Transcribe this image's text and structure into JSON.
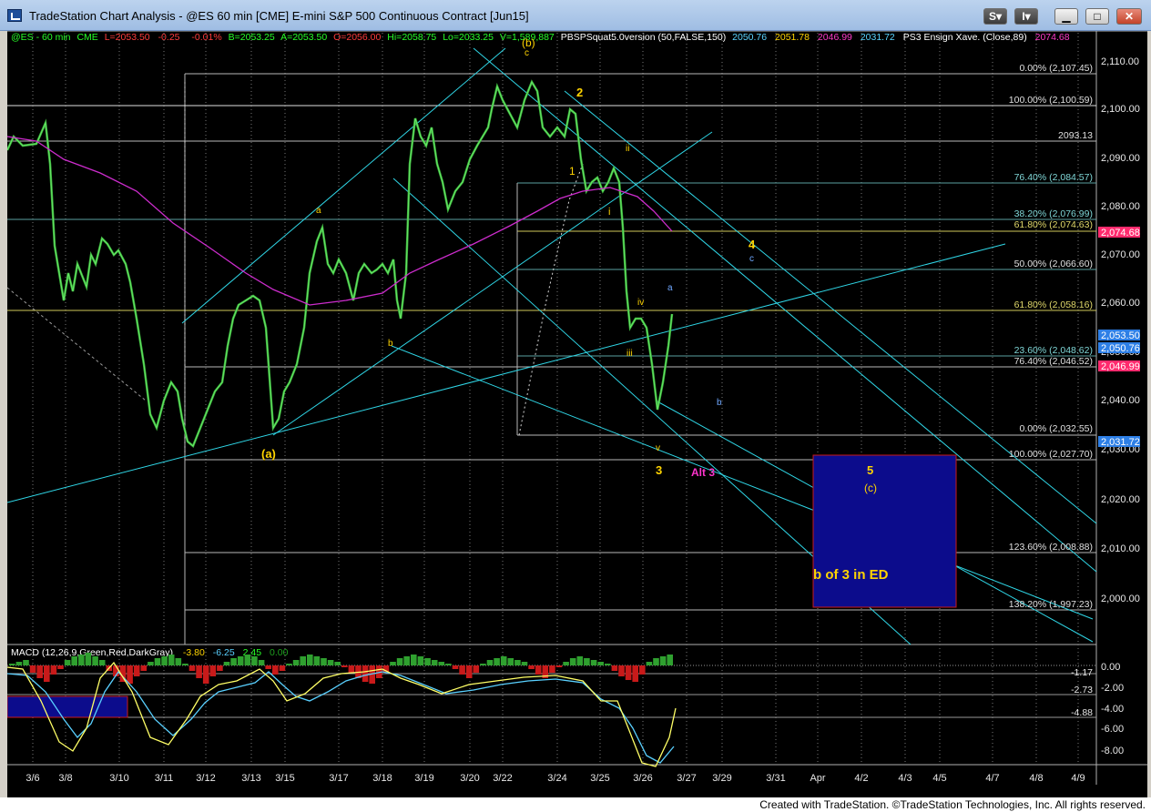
{
  "window": {
    "title": "TradeStation Chart Analysis - @ES 60 min [CME] E-mini S&P 500 Continuous Contract [Jun15]",
    "buttons": [
      "S",
      "I"
    ],
    "controls": [
      "minimize",
      "maximize",
      "close"
    ]
  },
  "header": {
    "symbol": "@ES - 60 min",
    "exchange": "CME",
    "last": "L=2053.50",
    "chg": "-0.25",
    "pct": "-0.01%",
    "bid": "B=2053.25",
    "ask": "A=2053.50",
    "open": "O=2056.00",
    "high": "Hi=2058.75",
    "low": "Lo=2033.25",
    "vol": "V=1,589,887",
    "indicator": "PBSPSquat5.0version (50,FALSE,150)",
    "ind_values": [
      "2050.76",
      "2051.78",
      "2046.99",
      "2031.72"
    ],
    "ensign": "PS3 Ensign Xave. (Close,89)",
    "ensign_value": "2074.68"
  },
  "price_axis": [
    "2,110.00",
    "2,100.00",
    "2,090.00",
    "2,080.00",
    "2,070.00",
    "2,060.00",
    "2,050.00",
    "2,040.00",
    "2,030.00",
    "2,020.00",
    "2,010.00",
    "2,000.00"
  ],
  "price_tags": [
    {
      "value": "2,074.68",
      "color": "#ff2a6d"
    },
    {
      "value": "2,053.50",
      "color": "#2d7fe6"
    },
    {
      "value": "2,050.76",
      "color": "#2d7fe6"
    },
    {
      "value": "2,046.99",
      "color": "#ff2a6d"
    },
    {
      "value": "2,031.72",
      "color": "#2d7fe6"
    }
  ],
  "fib_labels": [
    {
      "text": "0.00% (2,107.45)",
      "price": 2107.45
    },
    {
      "text": "100.00% (2,100.59)",
      "price": 2100.59
    },
    {
      "text": "2093.13",
      "price": 2093.13
    },
    {
      "text": "76.40% (2,084.57)",
      "price": 2084.57
    },
    {
      "text": "38.20% (2,076.99)",
      "price": 2076.99
    },
    {
      "text": "61.80% (2,074.63)",
      "price": 2074.63
    },
    {
      "text": "50.00% (2,066.60)",
      "price": 2066.6
    },
    {
      "text": "61.80% (2,058.16)",
      "price": 2058.16
    },
    {
      "text": "23.60% (2,048.62)",
      "price": 2048.62
    },
    {
      "text": "76.40% (2,046.52)",
      "price": 2046.52
    },
    {
      "text": "0.00% (2,032.55)",
      "price": 2032.55
    },
    {
      "text": "100.00% (2,027.70)",
      "price": 2027.7
    },
    {
      "text": "123.60% (2,008.88)",
      "price": 2008.88
    },
    {
      "text": "138.20% (1,997.23)",
      "price": 1997.23
    }
  ],
  "wave_labels": [
    {
      "text": "(b)",
      "color": "#ffd400"
    },
    {
      "text": "c",
      "color": "#ffd400"
    },
    {
      "text": "2",
      "color": "#ffd400"
    },
    {
      "text": "ii",
      "color": "#ffd400"
    },
    {
      "text": "1",
      "color": "#ffd400"
    },
    {
      "text": "i",
      "color": "#ffd400"
    },
    {
      "text": "a",
      "color": "#ffd400"
    },
    {
      "text": "b",
      "color": "#ffd400"
    },
    {
      "text": "(a)",
      "color": "#ffd400"
    },
    {
      "text": "iv",
      "color": "#ffd400"
    },
    {
      "text": "iii",
      "color": "#ffd400"
    },
    {
      "text": "v",
      "color": "#ffd400"
    },
    {
      "text": "3",
      "color": "#ffd400"
    },
    {
      "text": "4",
      "color": "#ffd400"
    },
    {
      "text": "c",
      "color": "#6fa8ff"
    },
    {
      "text": "a",
      "color": "#6fa8ff"
    },
    {
      "text": "b",
      "color": "#6fa8ff"
    },
    {
      "text": "Alt 3",
      "color": "#ff33cc"
    },
    {
      "text": "5",
      "color": "#ffd400"
    },
    {
      "text": "(c)",
      "color": "#ffd400"
    }
  ],
  "target_box_label": "b of 3 in ED",
  "macd": {
    "title": "MACD (12,26,9,Green,Red,DarkGray)",
    "values": [
      {
        "text": "-3.80",
        "color": "#ffd400"
      },
      {
        "text": "-6.25",
        "color": "#59d0ff"
      },
      {
        "text": "2.45",
        "color": "#27ff27"
      },
      {
        "text": "0.00",
        "color": "#1fa01f"
      }
    ],
    "axis": [
      "0.00",
      "-2.00",
      "-4.00",
      "-6.00",
      "-8.00"
    ],
    "levels": [
      "-1.17",
      "-2.73",
      "-4.88"
    ]
  },
  "time_axis": [
    "3/6",
    "3/8",
    "3/10",
    "3/11",
    "3/12",
    "3/13",
    "3/15",
    "3/17",
    "3/18",
    "3/19",
    "3/20",
    "3/22",
    "3/24",
    "3/25",
    "3/26",
    "3/27",
    "3/29",
    "3/31",
    "Apr",
    "4/2",
    "4/3",
    "4/5",
    "4/7",
    "4/8",
    "4/9"
  ],
  "footer": "Created with TradeStation. ©TradeStation Technologies, Inc. All rights reserved."
}
